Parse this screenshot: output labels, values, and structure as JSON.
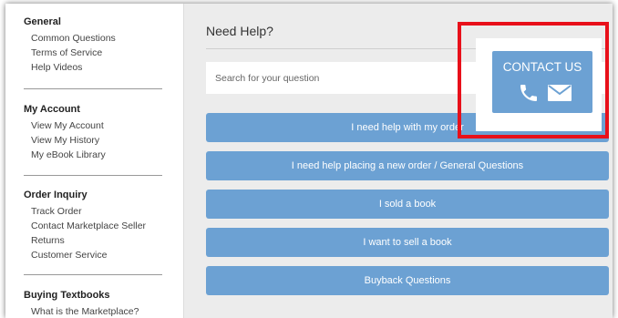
{
  "sidebar": {
    "sections": [
      {
        "title": "General",
        "links": [
          "Common Questions",
          "Terms of Service",
          "Help Videos"
        ]
      },
      {
        "title": "My Account",
        "links": [
          "View My Account",
          "View My History",
          "My eBook Library"
        ]
      },
      {
        "title": "Order Inquiry",
        "links": [
          "Track Order",
          "Contact Marketplace Seller",
          "Returns",
          "Customer Service"
        ]
      },
      {
        "title": "Buying Textbooks",
        "links": [
          "What is the Marketplace?"
        ]
      }
    ]
  },
  "main": {
    "heading": "Need Help?",
    "search_placeholder": "Search for your question",
    "buttons": [
      "I need help with my order",
      "I need help placing a new order / General Questions",
      "I sold a book",
      "I want to sell a book",
      "Buyback Questions"
    ]
  },
  "contact": {
    "label": "CONTACT US",
    "icons": [
      "phone-icon",
      "mail-icon"
    ]
  },
  "colors": {
    "button": "#6ca1d3",
    "highlight": "#e8101a",
    "background": "#ececec"
  }
}
